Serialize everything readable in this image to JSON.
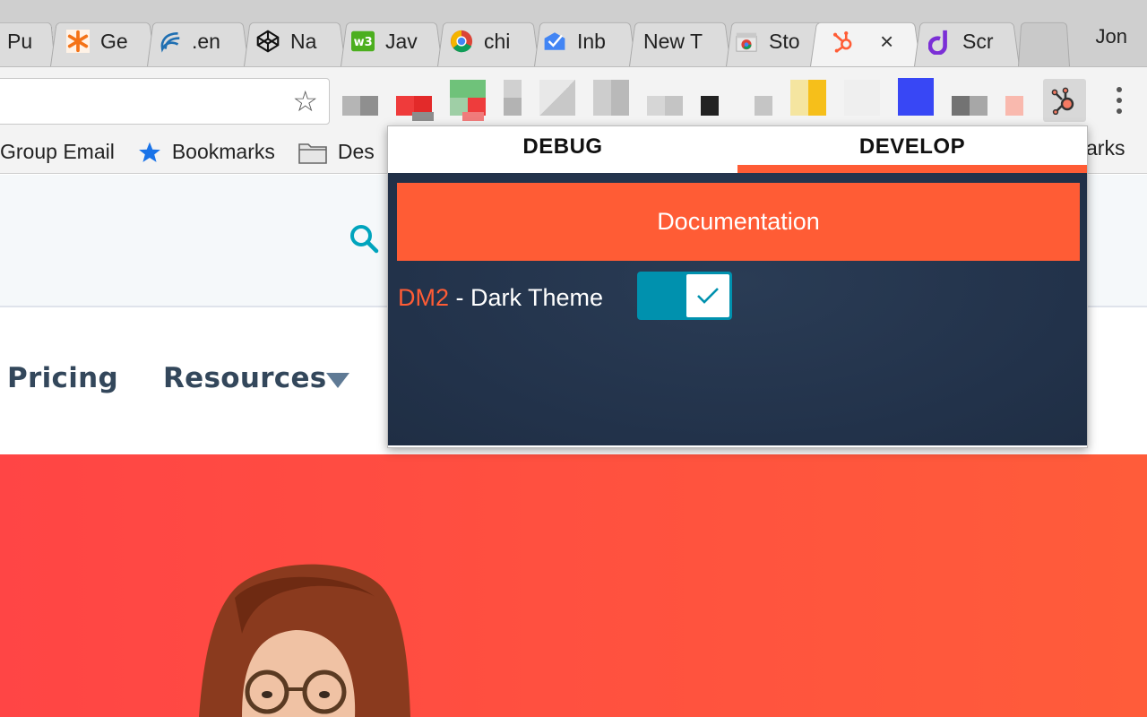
{
  "browser": {
    "tabs": [
      {
        "label": "Pu",
        "icon": "page-icon"
      },
      {
        "label": "Ge",
        "icon": "asterisk-icon"
      },
      {
        "label": ".en",
        "icon": "wave-icon"
      },
      {
        "label": "Na",
        "icon": "codepen-icon"
      },
      {
        "label": "Jav",
        "icon": "w3-icon"
      },
      {
        "label": "chi",
        "icon": "chrome-icon"
      },
      {
        "label": "Inb",
        "icon": "inbox-icon"
      },
      {
        "label": "New T",
        "icon": ""
      },
      {
        "label": "Sto",
        "icon": "webstore-icon"
      },
      {
        "label": "",
        "icon": "hubspot-icon",
        "close": "×"
      },
      {
        "label": "Scr",
        "icon": "drop-icon"
      }
    ],
    "user": "Jon",
    "bookmarks": [
      {
        "label": "Group Email",
        "icon": ""
      },
      {
        "label": "Bookmarks",
        "icon": "star-icon"
      },
      {
        "label": "Des",
        "icon": "folder-icon"
      }
    ],
    "bookmarks_right": "arks"
  },
  "page": {
    "nav": {
      "pricing": "Pricing",
      "resources": "Resources"
    }
  },
  "popup": {
    "tabs": [
      {
        "label": "DEBUG",
        "active": false
      },
      {
        "label": "DEVELOP",
        "active": true
      }
    ],
    "documentation_label": "Documentation",
    "theme_code": "DM2",
    "theme_label": " - Dark Theme",
    "dark_theme_enabled": true
  },
  "colors": {
    "accent": "#ff5c35",
    "toggle": "#0091ae",
    "popup_bg": "#22324a",
    "nav_text": "#33475b"
  }
}
